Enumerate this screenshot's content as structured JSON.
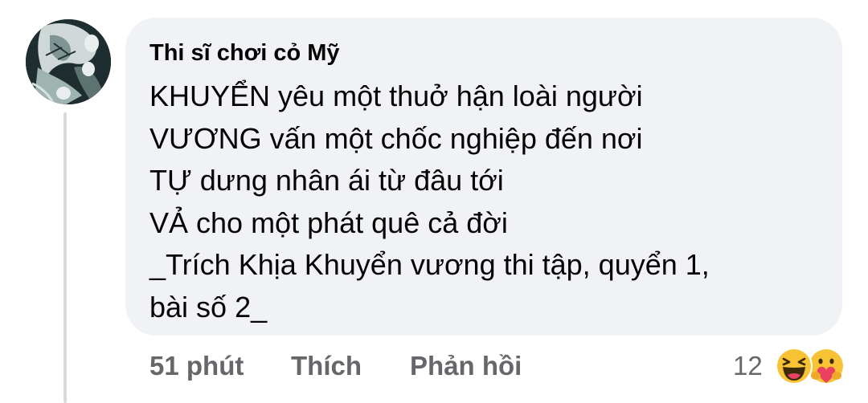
{
  "comment": {
    "author": "Thi sĩ chơi cỏ Mỹ",
    "lines": [
      "KHUYỂN yêu một thuở hận loài người",
      "VƯƠNG vấn một chốc nghiệp đến nơi",
      "TỰ dưng nhân ái từ đâu tới",
      "VẢ cho một phát quê cả đời",
      "_Trích Khịa Khuyển vương thi tập, quyển 1,",
      "bài số 2_"
    ]
  },
  "actions": {
    "time": "51 phút",
    "like_label": "Thích",
    "reply_label": "Phản hồi"
  },
  "reactions": {
    "count": "12",
    "icons": [
      "haha-emoji-icon",
      "care-emoji-icon"
    ]
  },
  "colors": {
    "bubble": "#f0f2f5",
    "text": "#050505",
    "secondary": "#65676b",
    "haha": "#f7c233",
    "care_heart": "#e9415f"
  }
}
